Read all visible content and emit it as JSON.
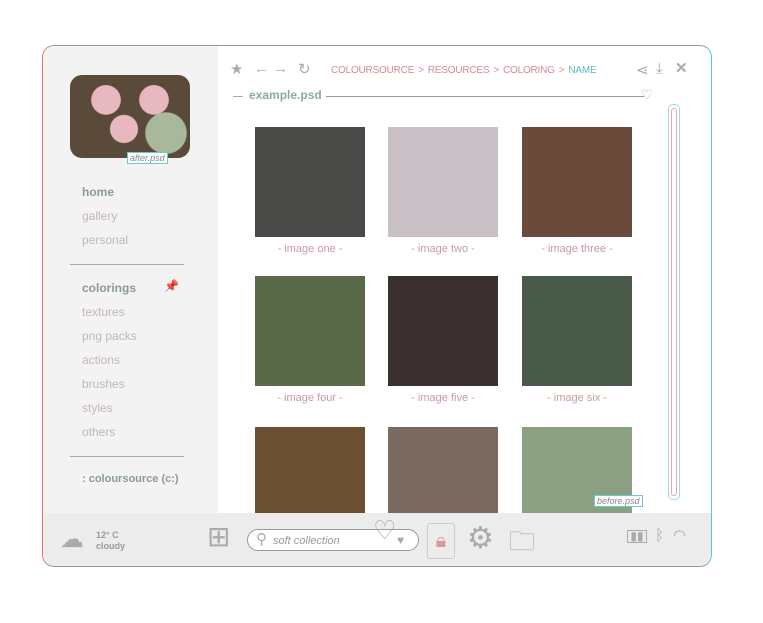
{
  "sidebar": {
    "thumb_label": "after.psd",
    "group1": [
      "home",
      "gallery",
      "personal"
    ],
    "group2": [
      "colorings",
      "textures",
      "png packs",
      "actions",
      "brushes",
      "styles",
      "others"
    ],
    "drive": ": coloursource (c:)"
  },
  "toolbar": {
    "breadcrumb": [
      "COLOURSOURCE",
      ">",
      "RESOURCES",
      ">",
      "COLORING",
      ">",
      "NAME"
    ]
  },
  "file": {
    "title": "example.psd"
  },
  "gallery": {
    "items": [
      {
        "caption": "- image one -",
        "color": "#4a4a48"
      },
      {
        "caption": "- image two -",
        "color": "#c8c0c4"
      },
      {
        "caption": "- image three -",
        "color": "#6a4a3a"
      },
      {
        "caption": "- image four -",
        "color": "#5a6a48"
      },
      {
        "caption": "- image five -",
        "color": "#3a3030"
      },
      {
        "caption": "- image six -",
        "color": "#4a5a48"
      },
      {
        "color": "#6a5030"
      },
      {
        "color": "#7a6a60"
      },
      {
        "color": "#8aa080"
      }
    ],
    "last_label": "before.psd"
  },
  "bottom": {
    "temp": "12° C",
    "weather": "cloudy",
    "search_placeholder": "soft collection"
  }
}
